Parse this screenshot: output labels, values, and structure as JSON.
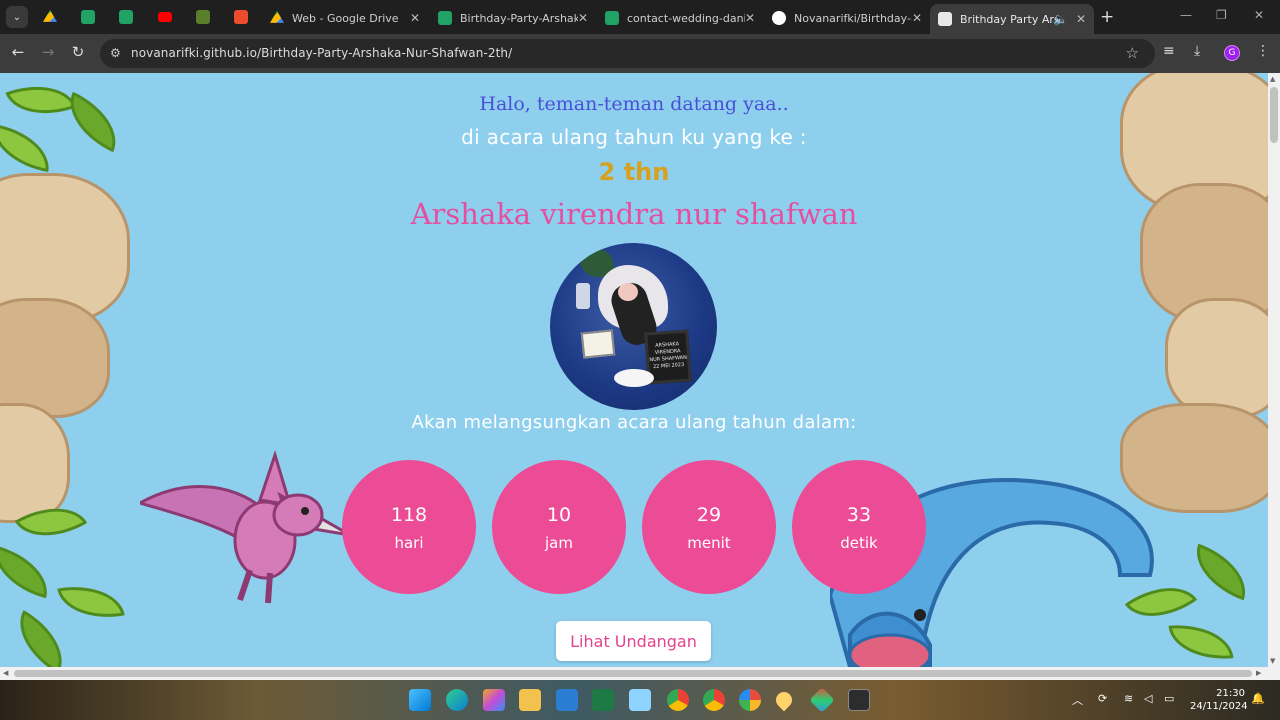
{
  "browser": {
    "tabs": [
      {
        "title": "Web - Google Drive",
        "fav_color": "#fbbc04"
      },
      {
        "title": "Birthday-Party-Arshaka-N",
        "fav_color": "#21a366"
      },
      {
        "title": "contact-wedding-dani",
        "fav_color": "#21a366"
      },
      {
        "title": "Novanarifki/Birthday-Pa",
        "fav_color": "#ffffff"
      },
      {
        "title": "Brithday Party Arsha",
        "fav_color": "#ffffff"
      }
    ],
    "tab_close": "✕",
    "new_tab": "+",
    "url": "novanarifki.github.io/Birthday-Party-Arshaka-Nur-Shafwan-2th/",
    "profile_initial": "G"
  },
  "page": {
    "greeting": "Halo, teman-teman datang yaa..",
    "subtitle": "di acara ulang tahun ku yang ke :",
    "age": "2 thn",
    "name": "Arshaka virendra nur shafwan",
    "photo_board_text": "ARSHAKA VIRENDRA NUR SHAFWAN 22 MEI 2023",
    "countdown_label": "Akan melangsungkan acara ulang tahun dalam:",
    "countdown": [
      {
        "value": "118",
        "unit": "hari"
      },
      {
        "value": "10",
        "unit": "jam"
      },
      {
        "value": "29",
        "unit": "menit"
      },
      {
        "value": "33",
        "unit": "detik"
      }
    ],
    "cta_label": "Lihat Undangan",
    "colors": {
      "sky": "#8ecfee",
      "greeting": "#4a4fd8",
      "age": "#d6a21e",
      "name": "#e54fa0",
      "circle": "#ec4b95"
    }
  },
  "taskbar": {
    "time": "21:30",
    "date": "24/11/2024"
  }
}
